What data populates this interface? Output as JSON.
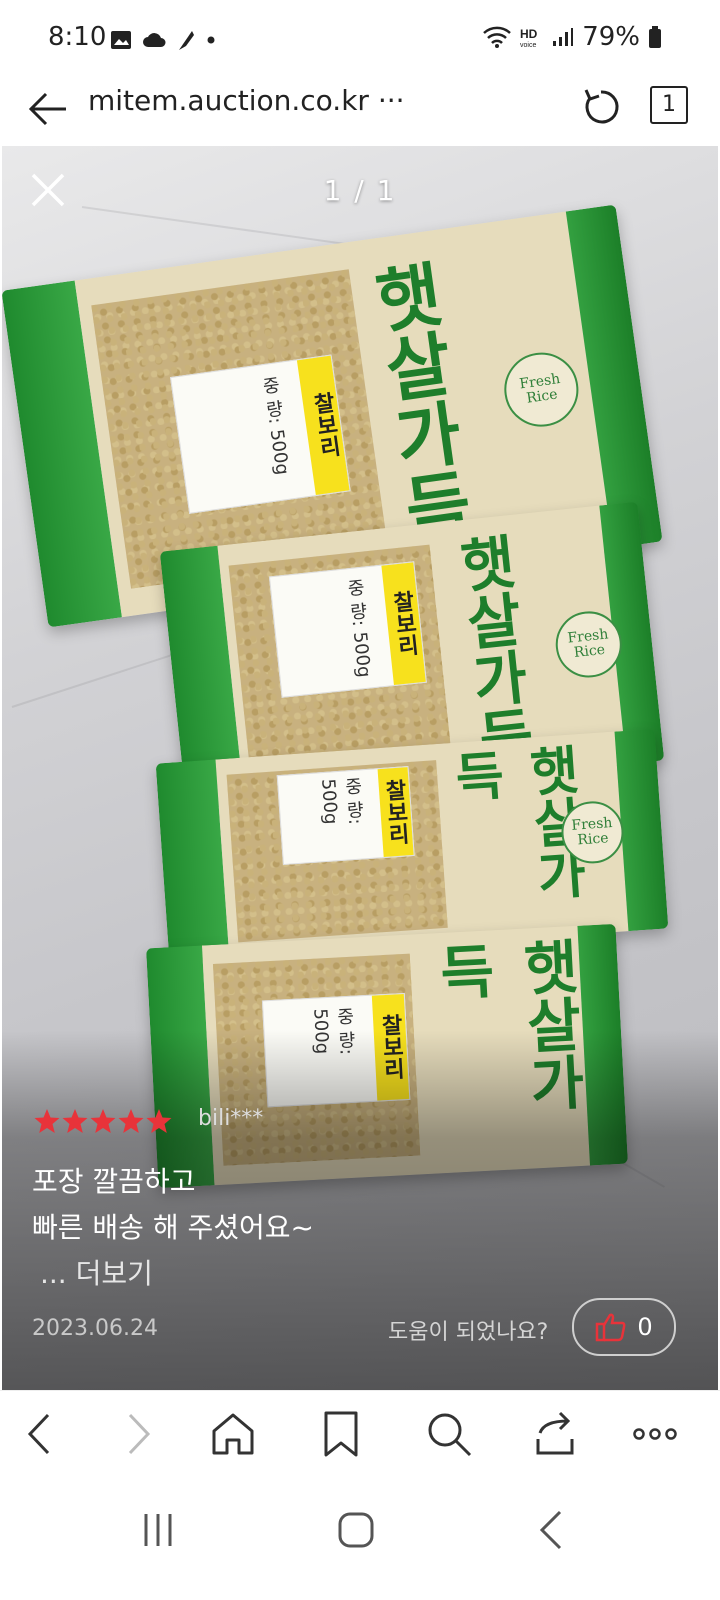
{
  "status_bar": {
    "time": "8:10",
    "battery": "79%",
    "left_icons": [
      "gallery-icon",
      "cloud-icon",
      "feather-icon",
      "dot-icon"
    ],
    "right_icons": [
      "wifi-icon",
      "hd-voice-icon",
      "signal-icon",
      "battery-icon"
    ]
  },
  "address_bar": {
    "url": "mitem.auction.co.kr ···",
    "tab_count": "1"
  },
  "viewer": {
    "counter": "1 / 1"
  },
  "review": {
    "rating": 5,
    "rating_max": 5,
    "reviewer": "bili***",
    "lines": [
      "포장 깔끔하고",
      "빠른 배송 해 주셨어요~"
    ],
    "more_label": "... 더보기",
    "date": "2023.06.24",
    "helpful_question": "도움이 되었나요?",
    "like_count": "0"
  },
  "product_label": {
    "name": "찰보리",
    "weight": "중 량: 500g",
    "brand": "햇살가득",
    "fresh_badge": "Fresh Rice"
  },
  "colors": {
    "star": "#e8333a",
    "bag_green": "#2a9a3a",
    "label_yellow": "#f7e11d"
  }
}
